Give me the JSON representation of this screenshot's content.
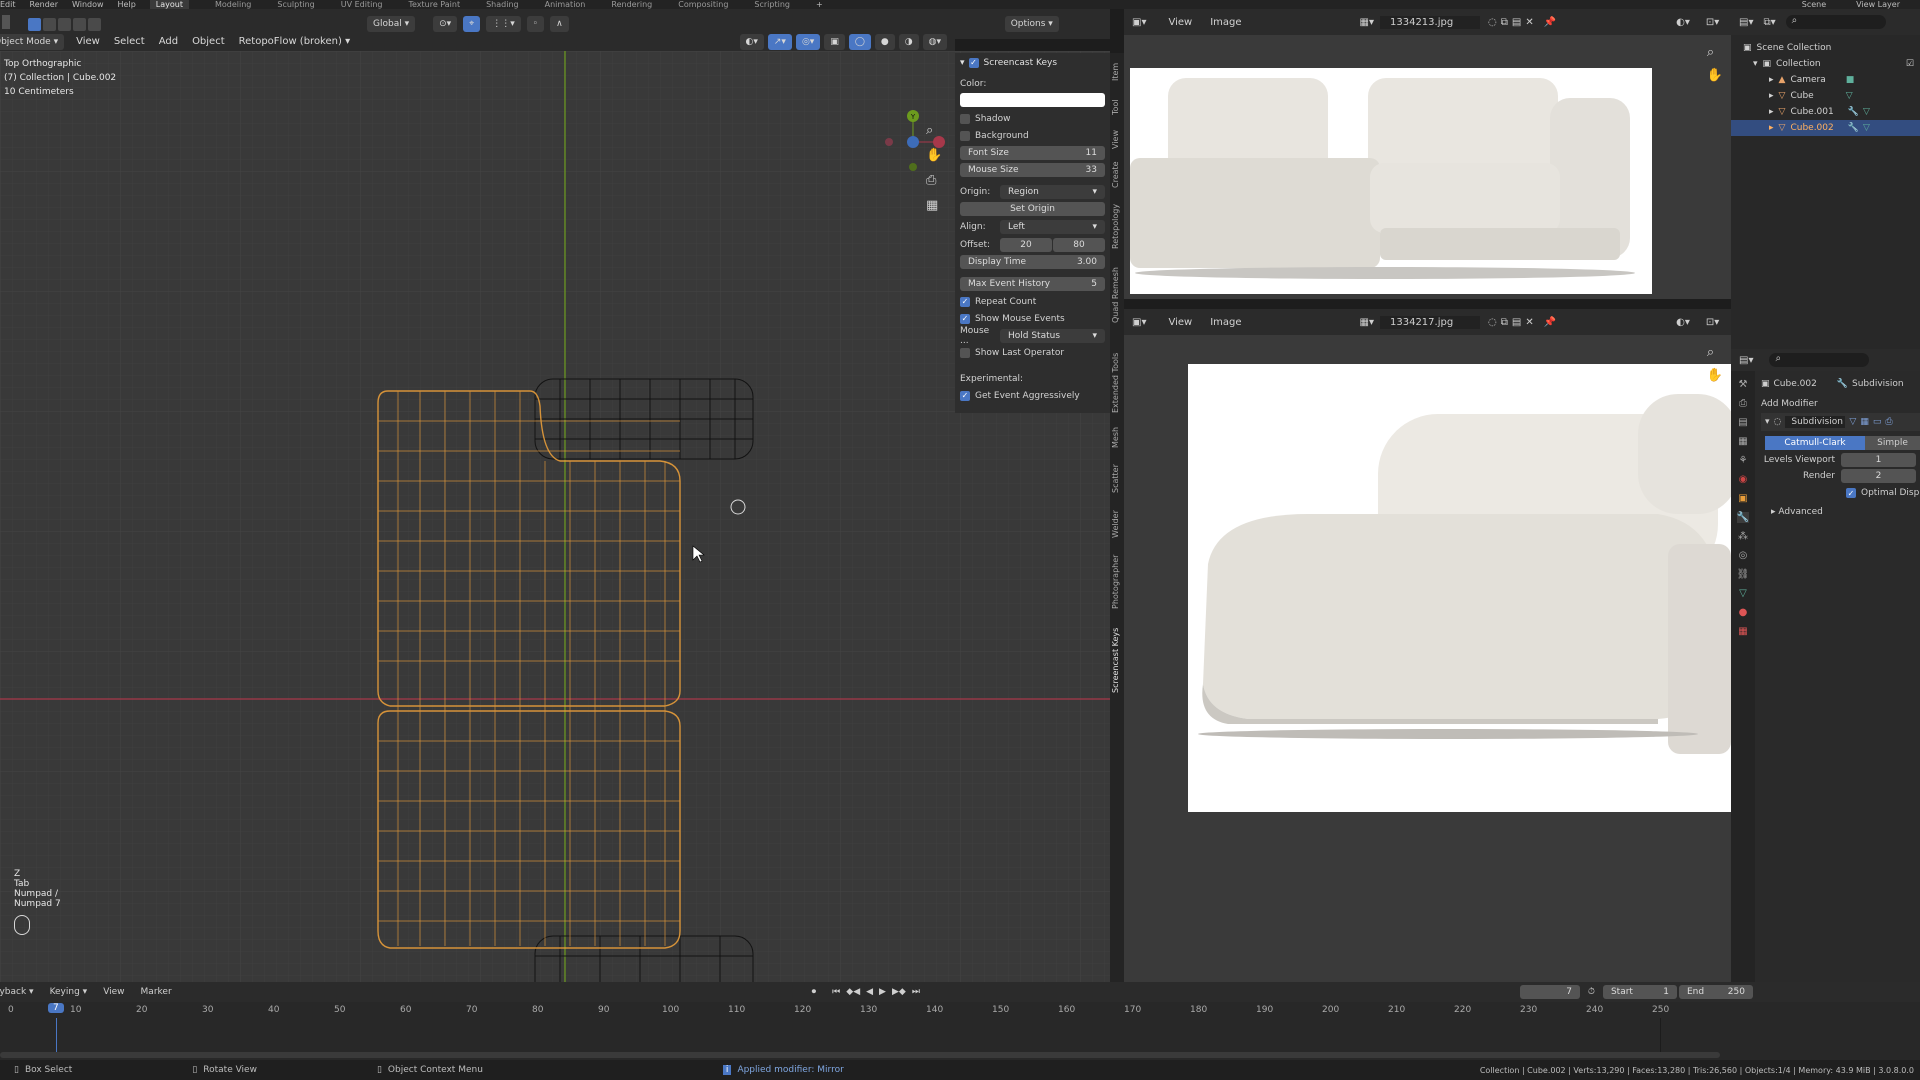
{
  "topbar": {
    "menus": [
      "Edit",
      "Render",
      "Window",
      "Help"
    ],
    "workspaces": [
      "Layout",
      "Modeling",
      "Sculpting",
      "UV Editing",
      "Texture Paint",
      "Shading",
      "Animation",
      "Rendering",
      "Compositing",
      "Scripting"
    ],
    "active_workspace": "Layout",
    "scene": "Scene",
    "view_layer": "View Layer"
  },
  "viewport": {
    "mode": "Object Mode",
    "menus": [
      "View",
      "Select",
      "Add",
      "Object"
    ],
    "addon_menu": "RetopoFlow (broken)",
    "orientation": "Global",
    "options": "Options",
    "overlay_lines": [
      "Top Orthographic",
      "(7) Collection | Cube.002",
      "10 Centimeters"
    ],
    "key_lines": [
      "Z",
      "Tab",
      "Numpad /",
      "Numpad 7"
    ],
    "gizmo": {
      "y": "Y",
      "z": "Z",
      "x": "X"
    }
  },
  "screencast": {
    "title": "Screencast Keys",
    "color_label": "Color:",
    "shadow": "Shadow",
    "background": "Background",
    "font_size_label": "Font Size",
    "font_size": "11",
    "mouse_size_label": "Mouse Size",
    "mouse_size": "33",
    "origin_label": "Origin:",
    "origin_value": "Region",
    "set_origin": "Set Origin",
    "align_label": "Align:",
    "align_value": "Left",
    "offset_label": "Offset:",
    "offset_x": "20",
    "offset_y": "80",
    "display_time_label": "Display Time",
    "display_time": "3.00",
    "max_event_label": "Max Event History",
    "max_event": "5",
    "repeat_count": "Repeat Count",
    "show_mouse_events": "Show Mouse Events",
    "mouse_label": "Mouse ...",
    "mouse_value": "Hold Status",
    "show_last_operator": "Show Last Operator",
    "experimental": "Experimental:",
    "get_event": "Get Event Aggressively"
  },
  "side_tabs": [
    "Item",
    "Tool",
    "View",
    "Create",
    "Retopology",
    "Quad Remesh",
    "Extended Tools",
    "Mesh",
    "Scatter",
    "Welder",
    "Photographer",
    "Screencast Keys"
  ],
  "image_editor_top": {
    "menus": [
      "View",
      "Image"
    ],
    "filename": "1334213.jpg"
  },
  "image_editor_bottom": {
    "menus": [
      "View",
      "Image"
    ],
    "filename": "1334217.jpg"
  },
  "outliner": {
    "scene_collection": "Scene Collection",
    "collection": "Collection",
    "items": [
      "Camera",
      "Cube",
      "Cube.001",
      "Cube.002"
    ],
    "selected": "Cube.002"
  },
  "properties": {
    "object": "Cube.002",
    "modifier_name_top": "Subdivision",
    "add_modifier": "Add Modifier",
    "modifier": "Subdivision",
    "catmull": "Catmull-Clark",
    "simple": "Simple",
    "levels_viewport_label": "Levels Viewport",
    "levels_viewport": "1",
    "render_label": "Render",
    "render": "2",
    "optimal_display": "Optimal Display",
    "advanced": "Advanced"
  },
  "timeline": {
    "menus": [
      "Playback",
      "Keying",
      "View",
      "Marker"
    ],
    "current_frame": "7",
    "start_label": "Start",
    "start": "1",
    "end_label": "End",
    "end": "250",
    "ticks": [
      "0",
      "10",
      "20",
      "30",
      "40",
      "50",
      "60",
      "70",
      "80",
      "90",
      "100",
      "110",
      "120",
      "130",
      "140",
      "150",
      "160",
      "170",
      "180",
      "190",
      "200",
      "210",
      "220",
      "230",
      "240",
      "250"
    ]
  },
  "statusbar": {
    "box_select": "Box Select",
    "rotate_view": "Rotate View",
    "context_menu": "Object Context Menu",
    "message": "Applied modifier: Mirror",
    "stats": "Collection | Cube.002 | Verts:13,290 | Faces:13,280 | Tris:26,560 | Objects:1/4 | Memory: 43.9 MiB | 3.0.8.0.0"
  },
  "colors": {
    "accent": "#4a77c4",
    "selection": "#e89d3a",
    "wire_dark": "#111111",
    "x_axis": "#a7384a",
    "y_axis": "#6c9b1e"
  }
}
